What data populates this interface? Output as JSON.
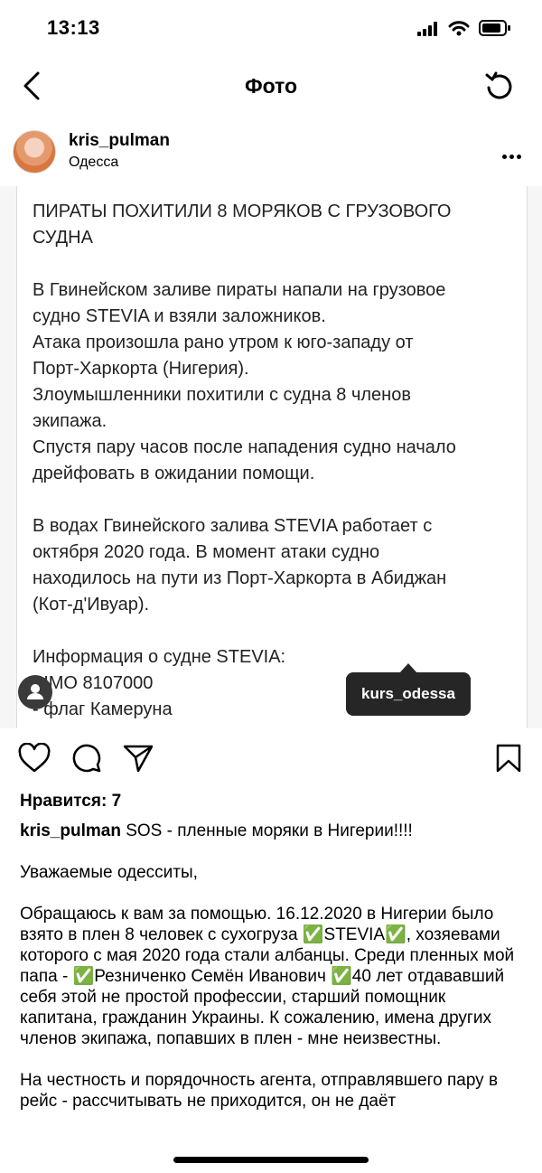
{
  "status_bar": {
    "time": "13:13"
  },
  "nav": {
    "title": "Фото"
  },
  "post": {
    "username": "kris_pulman",
    "location": "Одесса",
    "photo_text": [
      "ПИРАТЫ ПОХИТИЛИ 8 МОРЯКОВ С ГРУЗОВОГО\nСУДНА",
      "В Гвинейском заливе пираты напали на грузовое\nсудно STEVIA и взяли заложников.\nАтака произошла рано утром к юго-западу от\nПорт-Харкорта (Нигерия).\nЗлоумышленники похитили с судна 8 членов\nэкипажа.\nСпустя пару часов после нападения судно начало\nдрейфовать в ожидании помощи.",
      "В водах Гвинейского залива STEVIA работает с\nоктября 2020 года. В момент атаки судно\nнаходилось на пути из Порт-Харкорта в Абиджан\n(Кот-д'Ивуар).",
      "Информация о судне STEVIA:\n- IMO 8107000\n- флаг Камеруна"
    ],
    "photo_tag": "kurs_odessa",
    "likes": "Нравится: 7",
    "caption_user": "kris_pulman",
    "caption_first": "SOS - пленные моряки в Нигерии!!!!",
    "caption_paragraphs": [
      "Уважаемые одесситы,",
      "Обращаюсь к вам за помощью. 16.12.2020 в Нигерии было взято в плен 8 человек с сухогруза ✅STEVIA✅, хозяевами которого с мая 2020 года стали албанцы. Среди пленных мой папа - ✅Резниченко Семён Иванович ✅40 лет отдававший себя этой не простой профессии, старший помощник капитана, гражданин Украины. К сожалению, имена других членов экипажа, попавших в плен - мне неизвестны.",
      "На честность и порядочность агента, отправлявшего пару в рейс - рассчитывать не приходится, он не даёт"
    ]
  },
  "icons": {
    "status": [
      "signal-icon",
      "wifi-icon",
      "battery-icon"
    ],
    "nav": [
      "back-icon",
      "refresh-icon"
    ],
    "actions": [
      "like-icon",
      "comment-icon",
      "share-icon",
      "save-icon"
    ]
  }
}
